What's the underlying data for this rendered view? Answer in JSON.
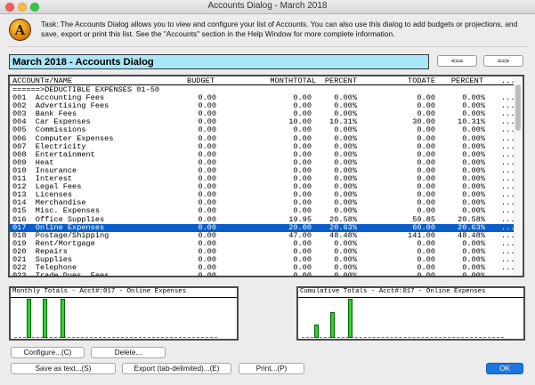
{
  "window": {
    "title": "Accounts Dialog - March 2018"
  },
  "app_icon": {
    "letter": "A",
    "icon": "app-logo-icon"
  },
  "task": {
    "text": "Task: The Accounts Dialog allows you to view and configure your list of Accounts. You can also use this dialog to add budgets or projections, and save, export or print this list. See the \"Accounts\" section in the Help Window for more complete information."
  },
  "dialog_title": "March 2018 - Accounts Dialog",
  "nav": {
    "prev_label": "<==",
    "next_label": "==>"
  },
  "table": {
    "headers": {
      "account": "ACCOUNT#/NAME",
      "budget": "BUDGET",
      "monthtotal": "MONTHTOTAL",
      "percent": "PERCENT",
      "todate": "TODATE",
      "percent2": "PERCENT",
      "more": "..."
    },
    "group_label": "======>DEDUCTIBLE EXPENSES 01-50",
    "rows": [
      {
        "acct": "001  Accounting Fees",
        "budget": "0.00",
        "month": "0.00",
        "pct": "0.00%",
        "todate": "0.00",
        "pct2": "0.00%",
        "more": "..."
      },
      {
        "acct": "002  Advertising Fees",
        "budget": "0.00",
        "month": "0.00",
        "pct": "0.00%",
        "todate": "0.00",
        "pct2": "0.00%",
        "more": "..."
      },
      {
        "acct": "003  Bank Fees",
        "budget": "0.00",
        "month": "0.00",
        "pct": "0.00%",
        "todate": "0.00",
        "pct2": "0.00%",
        "more": "..."
      },
      {
        "acct": "004  Car Expenses",
        "budget": "0.00",
        "month": "10.00",
        "pct": "10.31%",
        "todate": "30.00",
        "pct2": "10.31%",
        "more": "..."
      },
      {
        "acct": "005  Commissions",
        "budget": "0.00",
        "month": "0.00",
        "pct": "0.00%",
        "todate": "0.00",
        "pct2": "0.00%",
        "more": "..."
      },
      {
        "acct": "006  Computer Expenses",
        "budget": "0.00",
        "month": "0.00",
        "pct": "0.00%",
        "todate": "0.00",
        "pct2": "0.00%",
        "more": "..."
      },
      {
        "acct": "007  Electricity",
        "budget": "0.00",
        "month": "0.00",
        "pct": "0.00%",
        "todate": "0.00",
        "pct2": "0.00%",
        "more": "..."
      },
      {
        "acct": "008  Entertainment",
        "budget": "0.00",
        "month": "0.00",
        "pct": "0.00%",
        "todate": "0.00",
        "pct2": "0.00%",
        "more": "..."
      },
      {
        "acct": "009  Heat",
        "budget": "0.00",
        "month": "0.00",
        "pct": "0.00%",
        "todate": "0.00",
        "pct2": "0.00%",
        "more": "..."
      },
      {
        "acct": "010  Insurance",
        "budget": "0.00",
        "month": "0.00",
        "pct": "0.00%",
        "todate": "0.00",
        "pct2": "0.00%",
        "more": "..."
      },
      {
        "acct": "011  Interest",
        "budget": "0.00",
        "month": "0.00",
        "pct": "0.00%",
        "todate": "0.00",
        "pct2": "0.00%",
        "more": "..."
      },
      {
        "acct": "012  Legal Fees",
        "budget": "0.00",
        "month": "0.00",
        "pct": "0.00%",
        "todate": "0.00",
        "pct2": "0.00%",
        "more": "..."
      },
      {
        "acct": "013  Licenses",
        "budget": "0.00",
        "month": "0.00",
        "pct": "0.00%",
        "todate": "0.00",
        "pct2": "0.00%",
        "more": "..."
      },
      {
        "acct": "014  Merchandise",
        "budget": "0.00",
        "month": "0.00",
        "pct": "0.00%",
        "todate": "0.00",
        "pct2": "0.00%",
        "more": "..."
      },
      {
        "acct": "015  Misc. Expenses",
        "budget": "0.00",
        "month": "0.00",
        "pct": "0.00%",
        "todate": "0.00",
        "pct2": "0.00%",
        "more": "..."
      },
      {
        "acct": "016  Office Supplies",
        "budget": "0.00",
        "month": "19.95",
        "pct": "20.58%",
        "todate": "59.85",
        "pct2": "20.58%",
        "more": "..."
      },
      {
        "acct": "017  Online Expenses",
        "budget": "0.00",
        "month": "20.00",
        "pct": "20.63%",
        "todate": "60.00",
        "pct2": "20.63%",
        "more": "...",
        "selected": true
      },
      {
        "acct": "018  Postage/Shipping",
        "budget": "0.00",
        "month": "47.00",
        "pct": "48.48%",
        "todate": "141.00",
        "pct2": "48.48%",
        "more": "..."
      },
      {
        "acct": "019  Rent/Mortgage",
        "budget": "0.00",
        "month": "0.00",
        "pct": "0.00%",
        "todate": "0.00",
        "pct2": "0.00%",
        "more": "..."
      },
      {
        "acct": "020  Repairs",
        "budget": "0.00",
        "month": "0.00",
        "pct": "0.00%",
        "todate": "0.00",
        "pct2": "0.00%",
        "more": "..."
      },
      {
        "acct": "021  Supplies",
        "budget": "0.00",
        "month": "0.00",
        "pct": "0.00%",
        "todate": "0.00",
        "pct2": "0.00%",
        "more": "..."
      },
      {
        "acct": "022  Telephone",
        "budget": "0.00",
        "month": "0.00",
        "pct": "0.00%",
        "todate": "0.00",
        "pct2": "0.00%",
        "more": "..."
      },
      {
        "acct": "023  Trade Dues, Fees",
        "budget": "0.00",
        "month": "0.00",
        "pct": "0.00%",
        "todate": "0.00",
        "pct2": "0.00%",
        "more": "..."
      }
    ]
  },
  "monthly_totals": {
    "title": "Monthly Totals - Acct#:017 - Online Expenses",
    "bar_levels": [
      1.0,
      1.0,
      1.0
    ]
  },
  "cumulative_totals": {
    "title": "Cumulative Totals - Acct#:017 - Online Expenses",
    "bar_levels": [
      0.33,
      0.67,
      1.0
    ]
  },
  "colors": {
    "bar_fill": "#1fde1f",
    "selection": "#0a5ec8",
    "title_bg": "#a8e6f8",
    "ok_button": "#1b76e2"
  },
  "buttons": {
    "configure": "Configure...(C)",
    "delete": "Delete...",
    "save_text": "Save as text...(S)",
    "export": "Export (tab-delimited)...(E)",
    "print": "Print...(P)",
    "ok": "OK"
  }
}
